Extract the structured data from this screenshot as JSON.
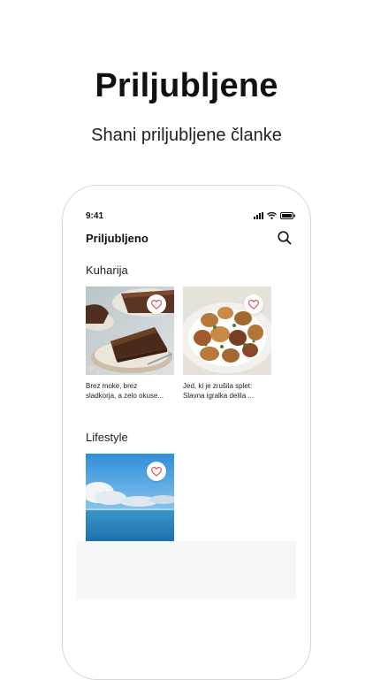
{
  "promo": {
    "title": "Priljubljene",
    "subtitle": "Shani priljubljene članke"
  },
  "status_bar": {
    "time": "9:41"
  },
  "app_bar": {
    "title": "Priljubljeno"
  },
  "sections": [
    {
      "label": "Kuharija",
      "items": [
        {
          "caption_line1": "Brez moke, brez",
          "caption_line2": "sladkorja, a zelo okuse...",
          "image": "chocolate-cake-photo"
        },
        {
          "caption_line1": "Jed, ki je zrušila splet:",
          "caption_line2": "Slavna igralka delila ...",
          "image": "roasted-potatoes-photo"
        }
      ]
    },
    {
      "label": "Lifestyle",
      "items": [
        {
          "image": "sea-sky-photo"
        }
      ]
    }
  ],
  "colors": {
    "heart": "#d94a4a",
    "panel": "#f6f7f8",
    "frame": "#d7d7d7"
  }
}
